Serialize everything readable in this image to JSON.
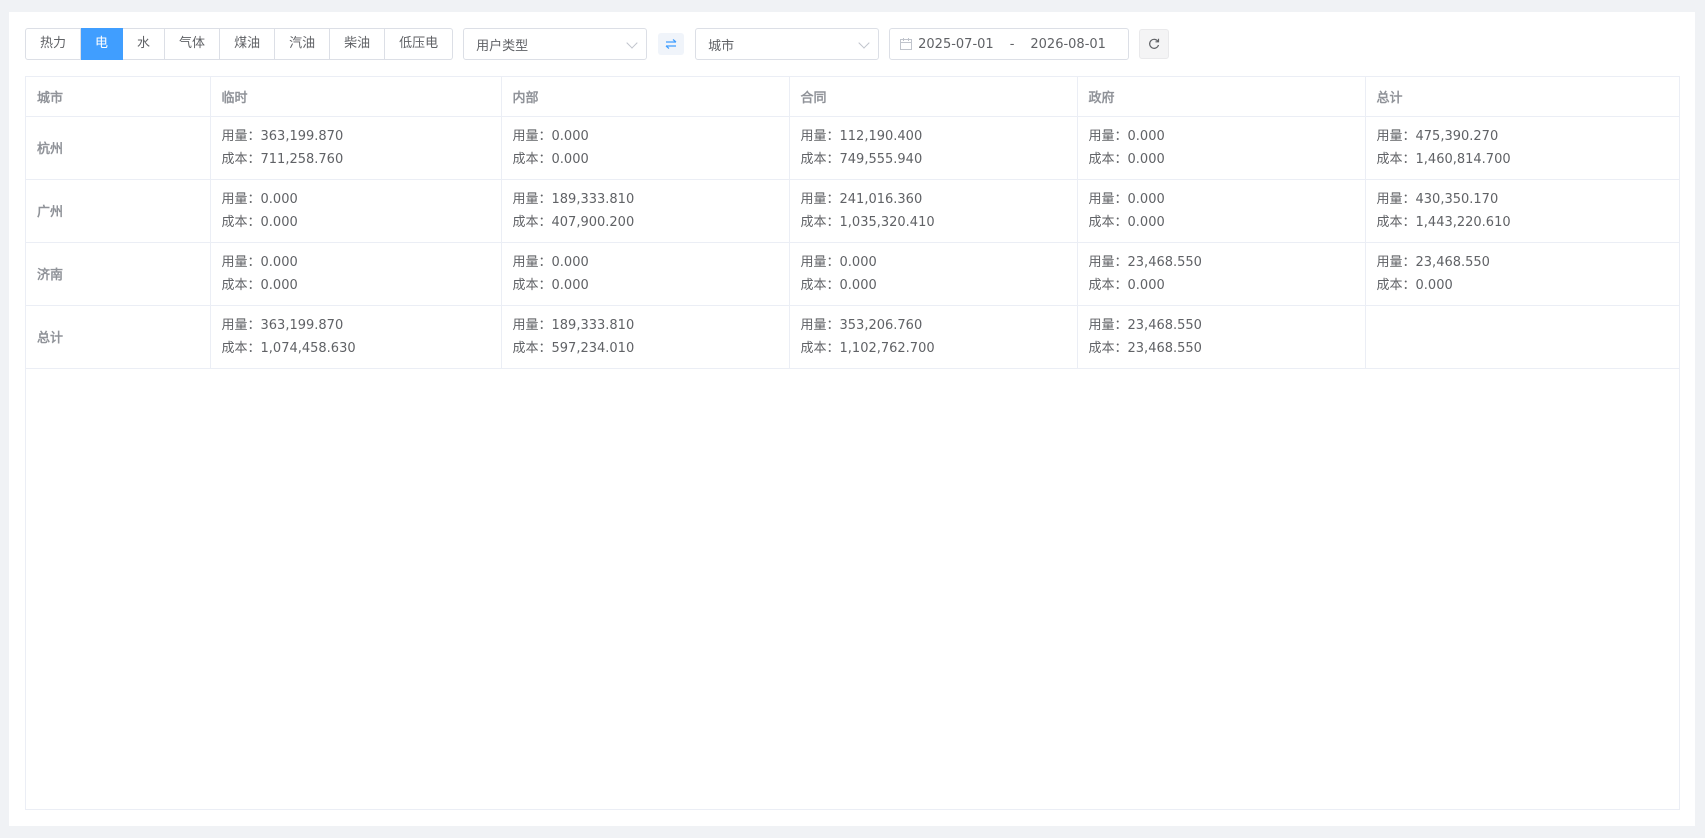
{
  "toolbar": {
    "energy_tabs": [
      {
        "label": "热力",
        "active": false
      },
      {
        "label": "电",
        "active": true
      },
      {
        "label": "水",
        "active": false
      },
      {
        "label": "气体",
        "active": false
      },
      {
        "label": "煤油",
        "active": false
      },
      {
        "label": "汽油",
        "active": false
      },
      {
        "label": "柴油",
        "active": false
      },
      {
        "label": "低压电",
        "active": false
      }
    ],
    "user_type_select": "用户类型",
    "swap_icon": "swap-icon",
    "city_select": "城市",
    "date_start": "2025-07-01",
    "date_separator": "-",
    "date_end": "2026-08-01",
    "refresh_icon": "refresh-icon"
  },
  "table": {
    "headers": [
      "城市",
      "临时",
      "内部",
      "合同",
      "政府",
      "总计"
    ],
    "usage_label": "用量：",
    "cost_label": "成本：",
    "rows": [
      {
        "city": "杭州",
        "cells": [
          {
            "usage": "363,199.870",
            "cost": "711,258.760"
          },
          {
            "usage": "0.000",
            "cost": "0.000"
          },
          {
            "usage": "112,190.400",
            "cost": "749,555.940"
          },
          {
            "usage": "0.000",
            "cost": "0.000"
          },
          {
            "usage": "475,390.270",
            "cost": "1,460,814.700"
          }
        ]
      },
      {
        "city": "广州",
        "cells": [
          {
            "usage": "0.000",
            "cost": "0.000"
          },
          {
            "usage": "189,333.810",
            "cost": "407,900.200"
          },
          {
            "usage": "241,016.360",
            "cost": "1,035,320.410"
          },
          {
            "usage": "0.000",
            "cost": "0.000"
          },
          {
            "usage": "430,350.170",
            "cost": "1,443,220.610"
          }
        ]
      },
      {
        "city": "济南",
        "cells": [
          {
            "usage": "0.000",
            "cost": "0.000"
          },
          {
            "usage": "0.000",
            "cost": "0.000"
          },
          {
            "usage": "0.000",
            "cost": "0.000"
          },
          {
            "usage": "23,468.550",
            "cost": "0.000"
          },
          {
            "usage": "23,468.550",
            "cost": "0.000"
          }
        ]
      },
      {
        "city": "总计",
        "cells": [
          {
            "usage": "363,199.870",
            "cost": "1,074,458.630"
          },
          {
            "usage": "189,333.810",
            "cost": "597,234.010"
          },
          {
            "usage": "353,206.760",
            "cost": "1,102,762.700"
          },
          {
            "usage": "23,468.550",
            "cost": "23,468.550"
          },
          null
        ]
      }
    ]
  },
  "colors": {
    "accent": "#409eff",
    "border": "#dcdfe6",
    "header_text": "#909399",
    "body_text": "#606266"
  }
}
